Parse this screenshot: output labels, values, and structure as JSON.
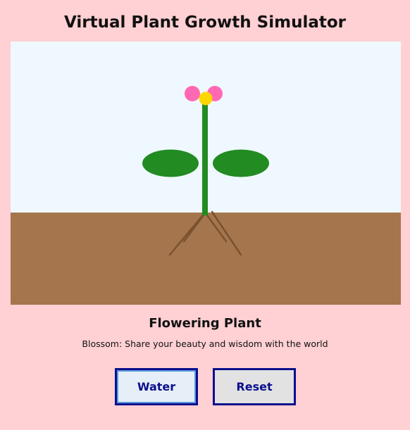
{
  "app": {
    "title": "Virtual Plant Growth Simulator"
  },
  "plant": {
    "stage_title": "Flowering Plant",
    "stage_message": "Blossom: Share your beauty and wisdom with the world"
  },
  "controls": {
    "water_label": "Water",
    "reset_label": "Reset"
  },
  "colors": {
    "page_background": "#ffd0d4",
    "sky": "#f0f8ff",
    "soil": "#a5764d",
    "root": "#7a5230",
    "stem": "#228b22",
    "leaf": "#228b22",
    "petal": "#ff69b4",
    "flower_center": "#ffd700",
    "button_text": "#0b0f8c"
  }
}
